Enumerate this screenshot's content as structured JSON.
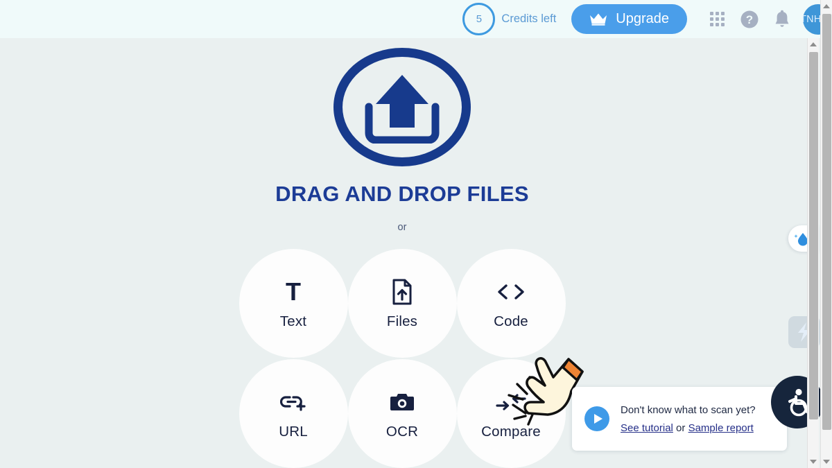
{
  "topbar": {
    "credits_count": "5",
    "credits_label": "Credits left",
    "upgrade_label": "Upgrade",
    "crown_icon": "crown-icon",
    "apps_icon": "apps-grid-icon",
    "help_icon": "help-circle-icon",
    "notifications_icon": "bell-icon",
    "avatar_initials": "TNHNH",
    "accent_blue": "#4a9eea",
    "credits_blue": "#5b9ad4"
  },
  "dropzone": {
    "upload_icon": "upload-arrow-icon",
    "headline": "DRAG AND DROP FILES",
    "or_text": "or",
    "navy": "#1c3c96"
  },
  "options": [
    {
      "label": "Text",
      "icon": "text-t-icon"
    },
    {
      "label": "Files",
      "icon": "file-upload-icon"
    },
    {
      "label": "Code",
      "icon": "angle-brackets-icon"
    },
    {
      "label": "URL",
      "icon": "link-plus-icon"
    },
    {
      "label": "OCR",
      "icon": "camera-icon"
    },
    {
      "label": "Compare",
      "icon": "compare-arrows-icon"
    }
  ],
  "tooltip": {
    "play_icon": "play-circle-icon",
    "question": "Don't know what to scan yet?",
    "link_tutorial": "See tutorial",
    "conjunction": " or ",
    "link_sample": "Sample report"
  },
  "widgets": {
    "drop_icon": "water-drop-sparkle-icon",
    "bolt_icon": "lightning-bolt-icon",
    "accessibility_icon": "wheelchair-accessibility-icon"
  },
  "cursor": {
    "hand_icon": "pointing-hand-click-icon"
  }
}
